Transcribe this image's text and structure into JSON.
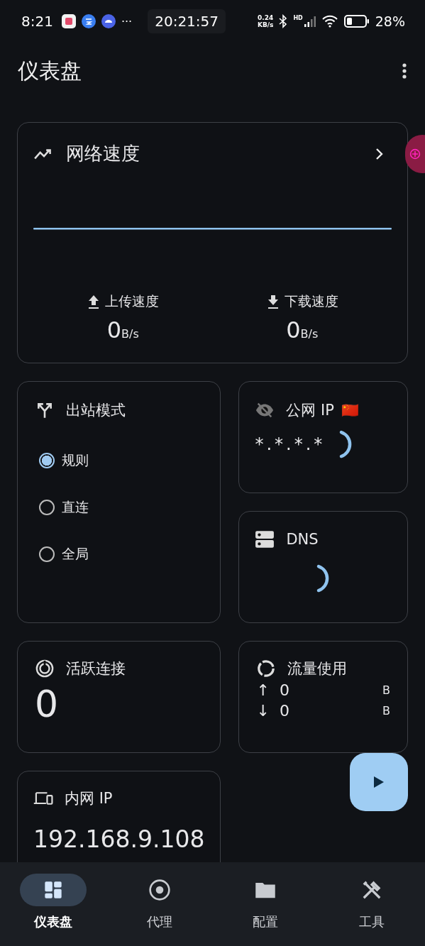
{
  "status_bar": {
    "time": "8:21",
    "more": "···",
    "clock": "20:21:57",
    "net_speed": [
      "0.24",
      "KB/s"
    ],
    "signal_label": "HD",
    "battery": "28%"
  },
  "app_bar": {
    "title": "仪表盘"
  },
  "network_speed": {
    "title": "网络速度",
    "upload": {
      "label": "上传速度",
      "value": "0",
      "unit": "B/s"
    },
    "download": {
      "label": "下载速度",
      "value": "0",
      "unit": "B/s"
    }
  },
  "outbound_mode": {
    "title": "出站模式",
    "options": [
      {
        "label": "规则",
        "selected": true
      },
      {
        "label": "直连",
        "selected": false
      },
      {
        "label": "全局",
        "selected": false
      }
    ]
  },
  "public_ip": {
    "title": "公网 IP",
    "flag": "🇨🇳",
    "value": "*.*.*.*",
    "loading": true
  },
  "dns": {
    "title": "DNS",
    "loading": true
  },
  "active_connections": {
    "title": "活跃连接",
    "value": "0"
  },
  "traffic": {
    "title": "流量使用",
    "rows": [
      {
        "arrow": "↑",
        "value": "0",
        "unit": "B"
      },
      {
        "arrow": "↓",
        "value": "0",
        "unit": "B"
      }
    ]
  },
  "local_ip": {
    "title": "内网 IP",
    "value": "192.168.9.108"
  },
  "nav": [
    {
      "label": "仪表盘",
      "kind": "dashboard",
      "selected": true
    },
    {
      "label": "代理",
      "kind": "proxy",
      "selected": false
    },
    {
      "label": "配置",
      "kind": "config",
      "selected": false
    },
    {
      "label": "工具",
      "kind": "tools",
      "selected": false
    }
  ]
}
